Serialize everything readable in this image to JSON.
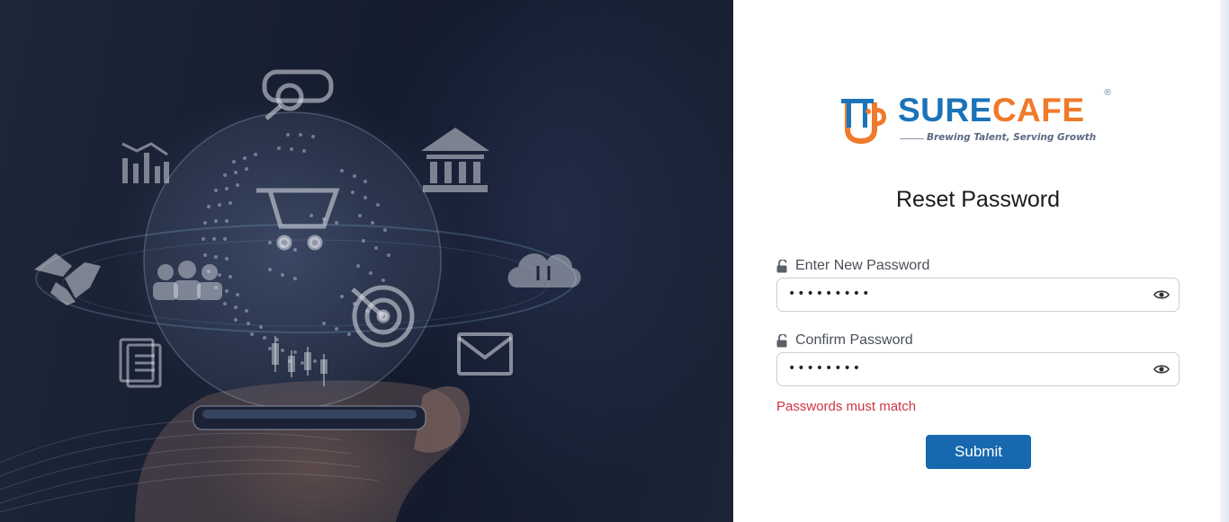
{
  "brand": {
    "name_part1": "SURE",
    "name_part2": "CAFE",
    "registered_mark": "®",
    "tagline": "Brewing Talent, Serving Growth",
    "colors": {
      "blue": "#1b73b8",
      "orange": "#f07a2a"
    }
  },
  "hero": {
    "icons": [
      "search-icon",
      "bank-icon",
      "chart-icon",
      "shopping-cart-icon",
      "handshake-icon",
      "team-icon",
      "cloud-transfer-icon",
      "target-icon",
      "document-icon",
      "candlestick-icon",
      "mail-icon",
      "globe-icon",
      "smartphone-icon"
    ]
  },
  "form": {
    "title": "Reset Password",
    "new_password": {
      "label": "Enter New Password",
      "value": "•••••••••"
    },
    "confirm_password": {
      "label": "Confirm Password",
      "value": "••••••••"
    },
    "error": "Passwords must match",
    "submit_label": "Submit",
    "colors": {
      "button": "#1768ae",
      "error": "#d0343f"
    }
  }
}
